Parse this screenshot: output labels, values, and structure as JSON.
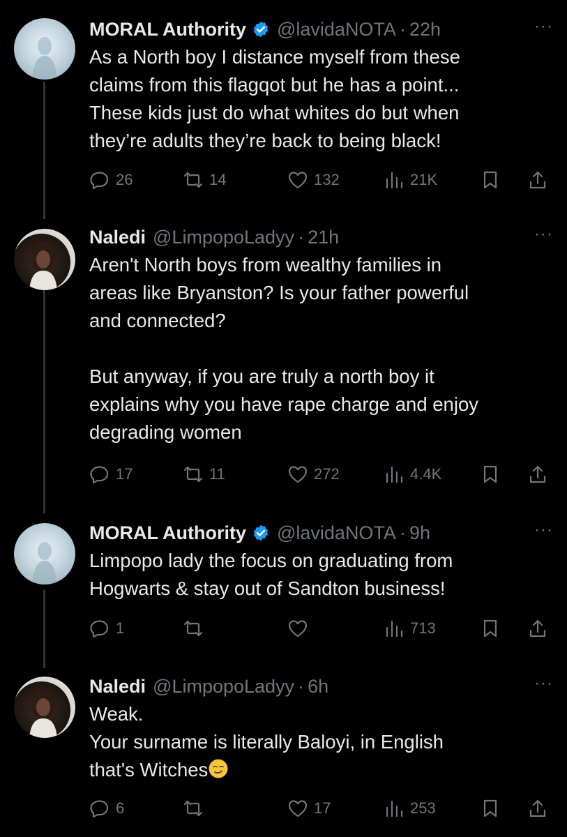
{
  "tweets": [
    {
      "avatar_icon": "avatar-moral-authority",
      "name": "MORAL Authority",
      "verified": true,
      "handle": "@lavidaNOTA",
      "dot": "·",
      "time": "22h",
      "more": "···",
      "text": "As a North boy I distance myself from these\nclaims from this flagqot but he has a point...\nThese kids just do what whites do but when\nthey’re adults they’re back to being black!",
      "replies": "26",
      "reposts": "14",
      "likes": "132",
      "views": "21K"
    },
    {
      "avatar_icon": "avatar-naledi",
      "name": "Naledi",
      "verified": false,
      "handle": "@LimpopoLadyy",
      "dot": "·",
      "time": "21h",
      "more": "···",
      "text": "Aren't North boys from wealthy families in\nareas like Bryanston? Is your father powerful\nand connected?\n\nBut anyway, if you are truly a north boy it\nexplains why you have rape charge and enjoy\ndegrading women",
      "replies": "17",
      "reposts": "11",
      "likes": "272",
      "views": "4.4K"
    },
    {
      "avatar_icon": "avatar-moral-authority",
      "name": "MORAL Authority",
      "verified": true,
      "handle": "@lavidaNOTA",
      "dot": "·",
      "time": "9h",
      "more": "···",
      "text": "Limpopo lady the focus on graduating from\nHogwarts & stay out of Sandton business!",
      "replies": "1",
      "reposts": "",
      "likes": "",
      "views": "713"
    },
    {
      "avatar_icon": "avatar-naledi",
      "name": "Naledi",
      "verified": false,
      "handle": "@LimpopoLadyy",
      "dot": "·",
      "time": "6h",
      "more": "···",
      "text": "Weak.\nYour surname is literally Baloyi, in English\nthat's Witches",
      "emoji": "smirking-face-emoji",
      "replies": "6",
      "reposts": "",
      "likes": "17",
      "views": "253"
    }
  ],
  "colors": {
    "background": "#000000",
    "text": "#e7e9ea",
    "secondary": "#71767b",
    "verified": "#1d9bf0",
    "thread_line": "#333639"
  }
}
